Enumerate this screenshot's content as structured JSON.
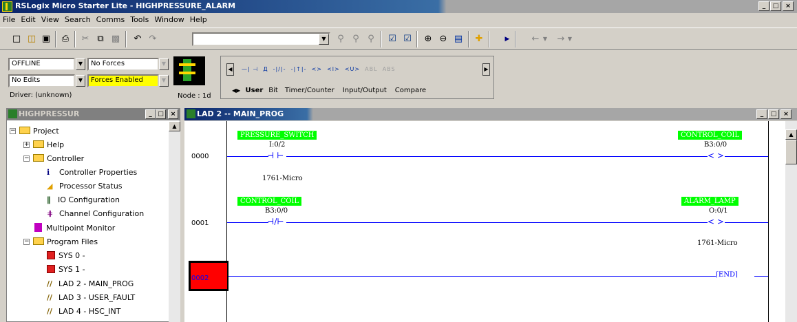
{
  "window": {
    "title": "RSLogix Micro Starter Lite - HIGHPRESSURE_ALARM",
    "caption_buttons": [
      "_",
      "□",
      "×"
    ]
  },
  "menu": [
    "File",
    "Edit",
    "View",
    "Search",
    "Comms",
    "Tools",
    "Window",
    "Help"
  ],
  "toolbar": {
    "combo_value": ""
  },
  "status": {
    "mode": "OFFLINE",
    "forces": "No Forces",
    "edits": "No Edits",
    "forces_enabled": "Forces Enabled",
    "driver": "Driver: (unknown)",
    "node": "Node : 1d"
  },
  "palette": {
    "instructions": [
      "—| ⊣",
      "Д",
      "‑|/|‑",
      "‑|↑|‑",
      "<>",
      "<l>",
      "<U>",
      "ABL",
      "ABS"
    ],
    "tabs": [
      "User",
      "Bit",
      "Timer/Counter",
      "Input/Output",
      "Compare"
    ]
  },
  "project": {
    "title": "HIGHPRESSUR",
    "items": [
      {
        "label": "Project",
        "icon": "folder-icon",
        "level": 0
      },
      {
        "label": "Help",
        "icon": "folder-icon",
        "level": 1
      },
      {
        "label": "Controller",
        "icon": "folder-icon",
        "level": 1
      },
      {
        "label": "Controller Properties",
        "icon": "info-icon",
        "level": 2
      },
      {
        "label": "Processor Status",
        "icon": "status-icon",
        "level": 2
      },
      {
        "label": "IO Configuration",
        "icon": "io-icon",
        "level": 2
      },
      {
        "label": "Channel Configuration",
        "icon": "channel-icon",
        "level": 2
      },
      {
        "label": "Multipoint Monitor",
        "icon": "monitor-icon",
        "level": 1
      },
      {
        "label": "Program Files",
        "icon": "folder-icon",
        "level": 1
      },
      {
        "label": "SYS 0 -",
        "icon": "sys-file-icon",
        "level": 2
      },
      {
        "label": "SYS 1 -",
        "icon": "sys-file-icon",
        "level": 2
      },
      {
        "label": "LAD 2 - MAIN_PROG",
        "icon": "ladder-file-icon",
        "level": 2
      },
      {
        "label": "LAD 3 - USER_FAULT",
        "icon": "ladder-file-icon",
        "level": 2
      },
      {
        "label": "LAD 4 - HSC_INT",
        "icon": "ladder-file-icon",
        "level": 2
      }
    ]
  },
  "ladder": {
    "title": "LAD 2 -- MAIN_PROG",
    "rungs": [
      {
        "number": "0000",
        "input_tag": "PRESSURE_SWITCH",
        "input_addr": "I:0/2",
        "input_desc": "1761-Micro",
        "output_tag": "CONTROL_COIL",
        "output_addr": "B3:0/0"
      },
      {
        "number": "0001",
        "input_tag": "CONTROL_COIL",
        "input_addr": "B3:0/0",
        "output_tag": "ALARM_LAMP",
        "output_addr": "O:0/1",
        "output_desc": "1761-Micro"
      },
      {
        "number": "0002",
        "output_label": "END"
      }
    ]
  },
  "colors": {
    "tag_bg": "#00ff00",
    "selected_rung": "#ff0000",
    "wire": "#0000ff"
  }
}
